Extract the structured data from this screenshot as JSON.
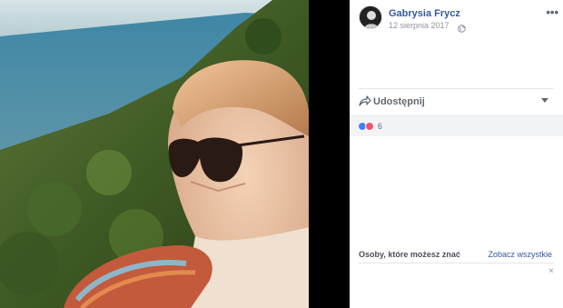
{
  "post": {
    "author_name": "Gabrysia Frycz",
    "date": "12 sierpnia 2017",
    "privacy_icon": "globe-icon",
    "more_icon": "more-options-icon",
    "more_label": "•••"
  },
  "actions": {
    "share_label": "Udostępnij",
    "share_icon": "share-arrow-icon"
  },
  "reactions": {
    "count": "6",
    "types": [
      "like-icon",
      "love-icon"
    ]
  },
  "people_you_may_know": {
    "title": "Osoby, które możesz znać",
    "see_all_label": "Zobacz wszystkie",
    "close_label": "×"
  },
  "colors": {
    "link_blue": "#365899",
    "secondary_text": "#90949c",
    "like_blue": "#4080ff",
    "love_red": "#f25268"
  }
}
